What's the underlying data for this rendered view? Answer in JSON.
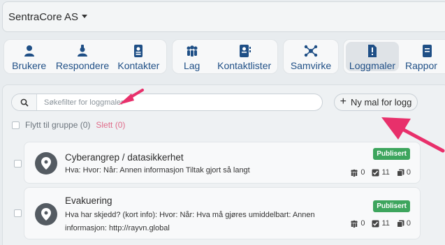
{
  "org": {
    "name": "SentraCore AS"
  },
  "nav": {
    "users": "Brukere",
    "responders": "Respondere",
    "contacts": "Kontakter",
    "teams": "Lag",
    "contact_lists": "Kontaktlister",
    "collaborate": "Samvirke",
    "log_templates": "Loggmaler",
    "reports": "Rappor"
  },
  "search": {
    "placeholder": "Søkefilter for loggmaler"
  },
  "new_button": {
    "label": "Ny mal for logg"
  },
  "bulk": {
    "move": "Flytt til gruppe (0)",
    "delete": "Slett (0)"
  },
  "items": [
    {
      "title": "Cyberangrep / datasikkerhet",
      "description": "Hva: Hvor: Når: Annen informasjon Tiltak gjort så langt",
      "badge": "Publisert",
      "groups": "0",
      "checks": "11",
      "copies": "0"
    },
    {
      "title": "Evakuering",
      "description_line1": "Hva har skjedd? (kort info): Hvor: Når: Hva må gjøres umiddelbart: Annen",
      "description_line2": "informasjon: http://rayvn.global",
      "badge": "Publisert",
      "groups": "0",
      "checks": "11",
      "copies": "0"
    }
  ],
  "colors": {
    "nav_text": "#1f4f86",
    "badge_bg": "#3da55d",
    "arrow": "#e8306b",
    "delete": "#e06c8a"
  }
}
